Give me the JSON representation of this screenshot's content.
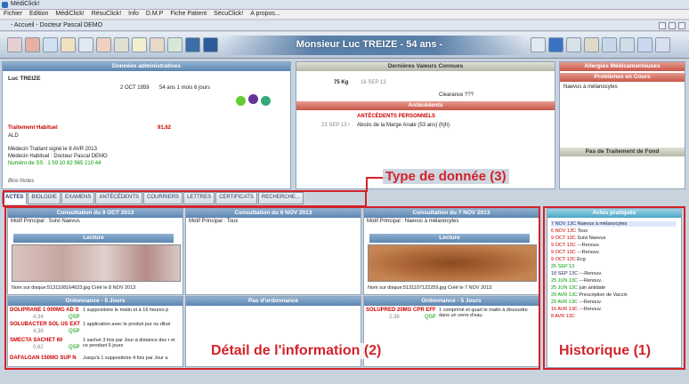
{
  "window": {
    "title": "MédiClick!",
    "subtitle": "- Accueil - Docteur Pascal DEMO"
  },
  "menu": [
    "Fichier",
    "Edition",
    "MédiClick!",
    "RésuClick!",
    "Info",
    "D.M.P",
    "Fiche Patient",
    "SécuClick!",
    "A propos..."
  ],
  "patient": "Monsieur Luc TREIZE - 54 ans -",
  "admin": {
    "header": "Données administratives",
    "name": "Luc TREIZE",
    "dob": "2 OCT 1959",
    "age": "54 ans 1 mois 6 jours",
    "traitement_label": "Traitement Habituel",
    "traitement_val": "91,62",
    "ald": "ALD",
    "medecin_traitant": "Médecin Traitant signé le 8 AVR 2013",
    "medecin_habituel": "Médecin Habituel : Docteur Pascal DEMO",
    "ss": "Numéro de SS :   1 59 10 82 965 210 44",
    "blocnotes": "Bloc-Notes"
  },
  "vitals": {
    "header": "Dernières Valeurs Connues",
    "poids": "75 Kg",
    "date": "16 SEP 13",
    "clearance": "Clearance ???"
  },
  "antecedents": {
    "header": "Antécédents",
    "sub": "ANTÉCÉDENTS PERSONNELS",
    "date": "23 SEP 13 r",
    "item": "Abcès de la Marge Anale (53 ans)  (hjh)"
  },
  "allergies": {
    "header": "Allergies Médicamenteuses"
  },
  "problemes": {
    "header": "Problèmes en Cours",
    "item": "Naevus à mélanocytes"
  },
  "pas_traitement": {
    "header": "Pas de Traitement de Fond"
  },
  "tabs": [
    "ACTES",
    "BIOLOGIE",
    "EXAMENS",
    "ANTÉCÉDENTS",
    "COURRIERS",
    "LETTRES",
    "CERTIFICATS",
    "RECHERCHE..."
  ],
  "consultations": [
    {
      "title": "Consultation du 9 OCT 2013",
      "motif": "Motif Principal : Suivi Naevus",
      "lecture": "Lecture",
      "fichier": "Nom sur disque:5131108164633.jpg  Créé le 8 NOV 2013",
      "ord_title": "Ordonnance  - 5 Jours",
      "ord": [
        {
          "drug": "DOLIPRANE 1 000MG AD S",
          "qty": "4,34",
          "qsp": "QSP",
          "posologie": "1 suppositoire le matin et à 16 heures p"
        },
        {
          "drug": "SOLUBACTER SOL US EXT",
          "qty": "4,38",
          "qsp": "QSP",
          "posologie": "1 application avec le produit pur ou dilué"
        },
        {
          "drug": "SMECTA SACHET 60",
          "qty": "0,62",
          "qsp": "QSP",
          "posologie": "1 sachet 3 fois par Jour à distance des r et ce pendant 6 jours"
        },
        {
          "drug": "DAFALGAN 150MG SUP N",
          "qty": "",
          "qsp": "",
          "posologie": "Jusqu'à 1 suppositoire 4 fois par Jour a"
        }
      ]
    },
    {
      "title": "Consultation du 6 NOV 2013",
      "motif": "Motif Principal : Toux",
      "ord_title": "Pas d'ordonnance"
    },
    {
      "title": "Consultation du 7 NOV 2013",
      "motif": "Motif Principal : Naevus à mélanocytes",
      "lecture": "Lecture",
      "fichier": "Nom sur disque:5131107122259.jpg  Créé le 7 NOV 2013",
      "ord_title": "Ordonnance  - 5 Jours",
      "ord": [
        {
          "drug": "SOLUPRED 20MG CPR EFF",
          "qty": "2,36",
          "qsp": "QSP",
          "posologie": "1 comprimé et quart le matin à dissoudre dans un verre d'eau."
        }
      ]
    }
  ],
  "historique": {
    "header": "Actes pratiqués",
    "rows": [
      {
        "date": "7 NOV 13C",
        "label": "Naevus à mélanocytes"
      },
      {
        "date": "6 NOV 13C",
        "label": "Toux"
      },
      {
        "date": "9 OCT 13C",
        "label": "Suivi Naevus"
      },
      {
        "date": "9 OCT 13C",
        "label": "---Renouv."
      },
      {
        "date": "9 OCT 13C",
        "label": "---Renouv."
      },
      {
        "date": "9 OCT 13C",
        "label": "Ecg"
      },
      {
        "date": "25 SEP 13",
        "label": ""
      },
      {
        "date": "18 SEP 13C",
        "label": "---Renouv."
      },
      {
        "date": "25 JUN 13C",
        "label": "---Renouv."
      },
      {
        "date": "25 JUN 13C",
        "label": "juin  antidate"
      },
      {
        "date": "29 AVR 13C",
        "label": "Prescription de Vaccin"
      },
      {
        "date": "29 AVR 13C",
        "label": "---Renouv."
      },
      {
        "date": "16 AVR 13C",
        "label": "---Renouv."
      },
      {
        "date": "8 AVR 13C",
        "label": ""
      }
    ]
  },
  "annotations": {
    "type": "Type de donnée (3)",
    "detail": "Détail de l'information (2)",
    "historique": "Historique (1)"
  },
  "colors": {
    "annotation": "#d2232a",
    "header_blue": "#5d86b0",
    "header_red": "#c8574a"
  }
}
